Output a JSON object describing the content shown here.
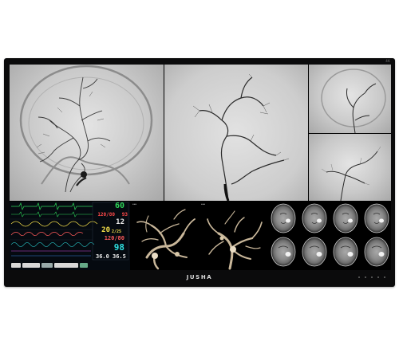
{
  "screen": {
    "top_tag": "4K",
    "brand": "JUSHA"
  },
  "vitals": {
    "hr": "60",
    "nibp": "120/80",
    "nibp_extra": "93",
    "rr": "12",
    "resp": "20",
    "resp_extra": "2/25",
    "art": "120/80",
    "spo2": "98",
    "temp1": "36.0",
    "temp2": "36.5",
    "colors": {
      "hr": "#2fd65a",
      "nibp": "#ff4a4a",
      "rr": "#e8e8e8",
      "resp": "#f4e04a",
      "art": "#ff5a5a",
      "spo2": "#2ee0e0"
    }
  }
}
